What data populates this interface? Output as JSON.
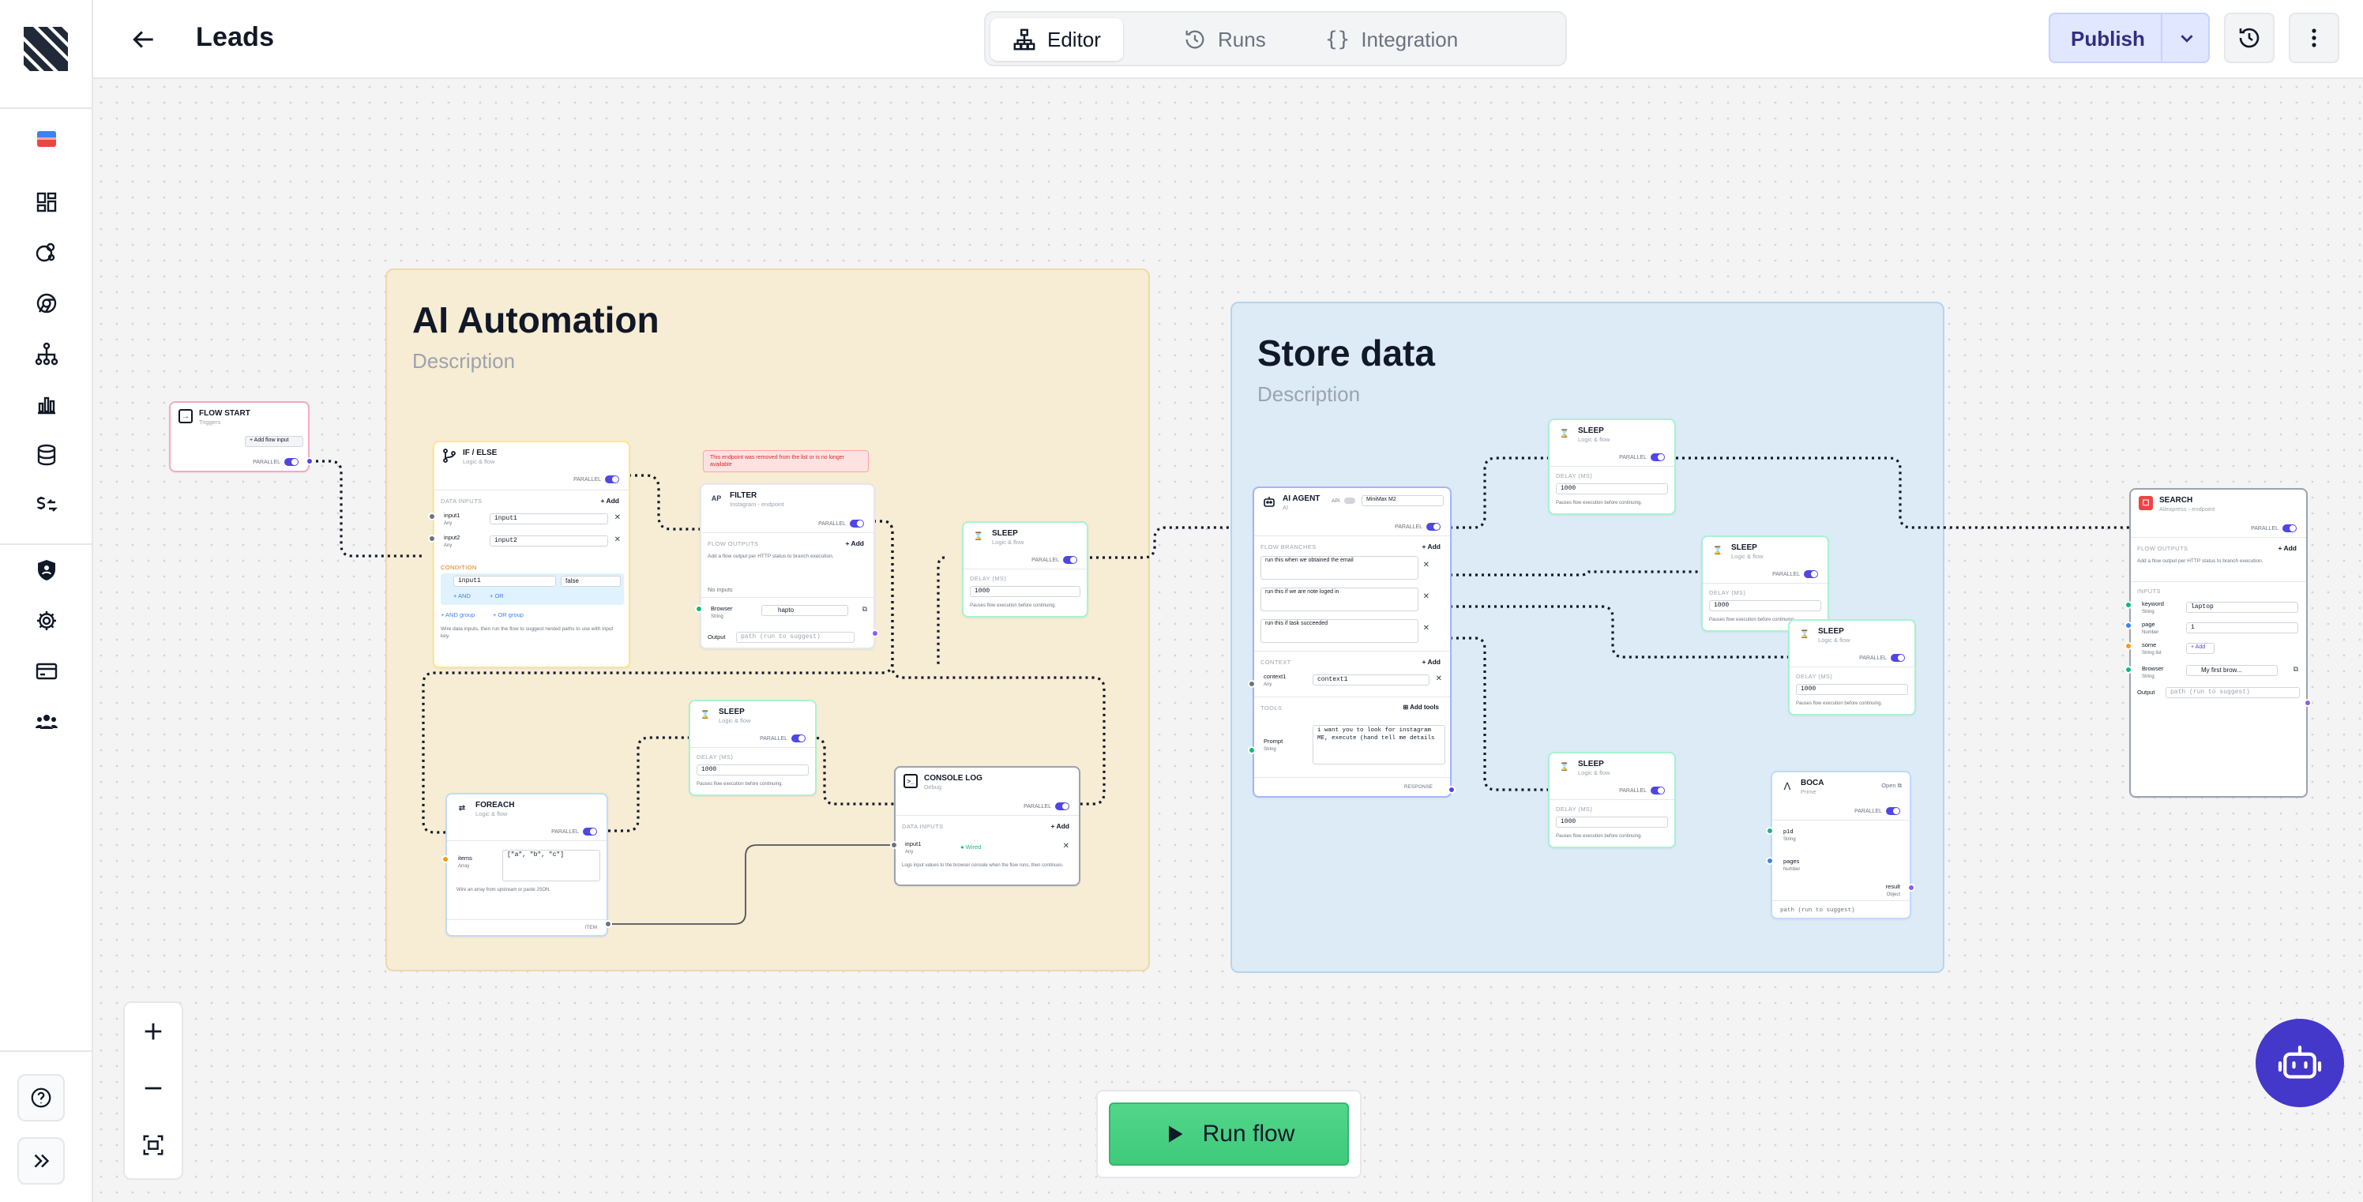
{
  "app": {
    "title": "Leads"
  },
  "header": {
    "tabs": [
      {
        "label": "Editor",
        "icon": "sitemap-icon",
        "active": true
      },
      {
        "label": "Runs",
        "icon": "history-icon"
      },
      {
        "label": "Integration",
        "icon": "braces-icon"
      }
    ],
    "publish_label": "Publish"
  },
  "groups": [
    {
      "title": "AI Automation",
      "description": "Description",
      "color": "#f7ecd4"
    },
    {
      "title": "Store data",
      "description": "Description",
      "color": "#dcebf6"
    }
  ],
  "nodes": {
    "flow_start": {
      "title": "FLOW START",
      "subtitle": "Triggers",
      "add_label": "+ Add flow input",
      "parallel": "PARALLEL"
    },
    "if_else": {
      "title": "IF / ELSE",
      "subtitle": "Logic & flow",
      "parallel": "PARALLEL",
      "data_inputs": "DATA INPUTS",
      "add": "+ Add",
      "input1_label": "input1",
      "input1_type": "Any",
      "input1_value": "input1",
      "input2_label": "input2",
      "input2_type": "Any",
      "input2_value": "input2",
      "condition": "CONDITION",
      "cond_value": "input1",
      "cond_op": "false",
      "and": "+ AND",
      "or": "+ OR",
      "and_group": "+ AND group",
      "or_group": "+ OR group",
      "hint": "Wire data inputs, then run the flow to suggest nested paths to use with input key."
    },
    "filter": {
      "warning": "This endpoint was removed from the list or is no longer available",
      "title": "FILTER",
      "subtitle": "Instagram - endpoint",
      "parallel": "PARALLEL",
      "flow_outputs": "FLOW OUTPUTS",
      "add": "+ Add",
      "desc": "Add a flow output per HTTP status to branch execution.",
      "no_inputs": "No inputs",
      "browser_label": "Browser",
      "browser_type": "String",
      "browser_value": "hapto",
      "output_label": "Output",
      "output_value": "path (run to suggest)"
    },
    "sleep1": {
      "title": "SLEEP",
      "subtitle": "Logic & flow",
      "parallel": "PARALLEL",
      "delay_label": "DELAY (MS)",
      "delay_value": "1000",
      "hint": "Pauses flow execution before continuing."
    },
    "sleep2": {
      "title": "SLEEP",
      "subtitle": "Logic & flow",
      "parallel": "PARALLEL",
      "delay_label": "DELAY (MS)",
      "delay_value": "1000",
      "hint": "Pauses flow execution before continuing."
    },
    "foreach": {
      "title": "FOREACH",
      "subtitle": "Logic & flow",
      "parallel": "PARALLEL",
      "items_label": "items",
      "items_type": "Array",
      "items_value": "[\"a\", \"b\", \"c\"]",
      "hint": "Wire an array from upstream or paste JSON.",
      "item_label": "ITEM"
    },
    "console_log": {
      "title": "CONSOLE LOG",
      "subtitle": "Debug",
      "parallel": "PARALLEL",
      "data_inputs": "DATA INPUTS",
      "add": "+ Add",
      "input1_label": "input1",
      "input1_type": "Any",
      "input1_value": "Wired",
      "hint": "Logs input values to the browser console when the flow runs, then continues."
    },
    "ai_agent": {
      "title": "AI AGENT",
      "subtitle": "AI",
      "api_label": "API",
      "model": "MiniMax M2",
      "parallel": "PARALLEL",
      "flow_branches": "FLOW BRANCHES",
      "add": "+ Add",
      "branch1": "run this when we obtained the email",
      "branch2": "run this if we are note loged in",
      "branch3": "run this if task succeeded",
      "context": "CONTEXT",
      "context_label": "context1",
      "context_type": "Any",
      "context_value": "context1",
      "tools": "TOOLS",
      "add_tools": "Add tools",
      "prompt_label": "Prompt",
      "prompt_type": "String",
      "prompt_value": "i want you to look for instagram ME, execute (hand tell me details",
      "response": "RESPONSE"
    },
    "sleep3": {
      "title": "SLEEP",
      "subtitle": "Logic & flow",
      "parallel": "PARALLEL",
      "delay_label": "DELAY (MS)",
      "delay_value": "1000",
      "hint": "Pauses flow execution before continuing."
    },
    "sleep4": {
      "title": "SLEEP",
      "subtitle": "Logic & flow",
      "parallel": "PARALLEL",
      "delay_label": "DELAY (MS)",
      "delay_value": "1000",
      "hint": "Pauses flow execution before continuing."
    },
    "sleep5": {
      "title": "SLEEP",
      "subtitle": "Logic & flow",
      "parallel": "PARALLEL",
      "delay_label": "DELAY (MS)",
      "delay_value": "1000",
      "hint": "Pauses flow execution before continuing."
    },
    "sleep6": {
      "title": "SLEEP",
      "subtitle": "Logic & flow",
      "parallel": "PARALLEL",
      "delay_label": "DELAY (MS)",
      "delay_value": "1000",
      "hint": "Pauses flow execution before continuing."
    },
    "boca": {
      "title": "BOCA",
      "subtitle": "Prime",
      "open": "Open",
      "parallel": "PARALLEL",
      "p1_label": "p1d",
      "p1_type": "String",
      "p2_label": "pages",
      "p2_type": "Number",
      "result_label": "result",
      "result_type": "Object",
      "output_value": "path (run to suggest)"
    },
    "search": {
      "title": "SEARCH",
      "subtitle": "Aliexpress - endpoint",
      "parallel": "PARALLEL",
      "flow_outputs": "FLOW OUTPUTS",
      "add": "+ Add",
      "desc": "Add a flow output per HTTP status to branch execution.",
      "inputs": "INPUTS",
      "keyword_label": "keyword",
      "keyword_type": "String",
      "keyword_value": "laptop",
      "page_label": "page",
      "page_type": "Number",
      "page_value": "1",
      "some_label": "some",
      "some_type": "String list",
      "add_small": "+ Add",
      "browser_label": "Browser",
      "browser_type": "String",
      "browser_value": "My first brow...",
      "output_label": "Output",
      "output_value": "path (run to suggest)"
    }
  },
  "run_label": "Run flow",
  "colors": {
    "accent": "#4f46e5",
    "run": "#4ade80",
    "bot": "#4338ca"
  }
}
